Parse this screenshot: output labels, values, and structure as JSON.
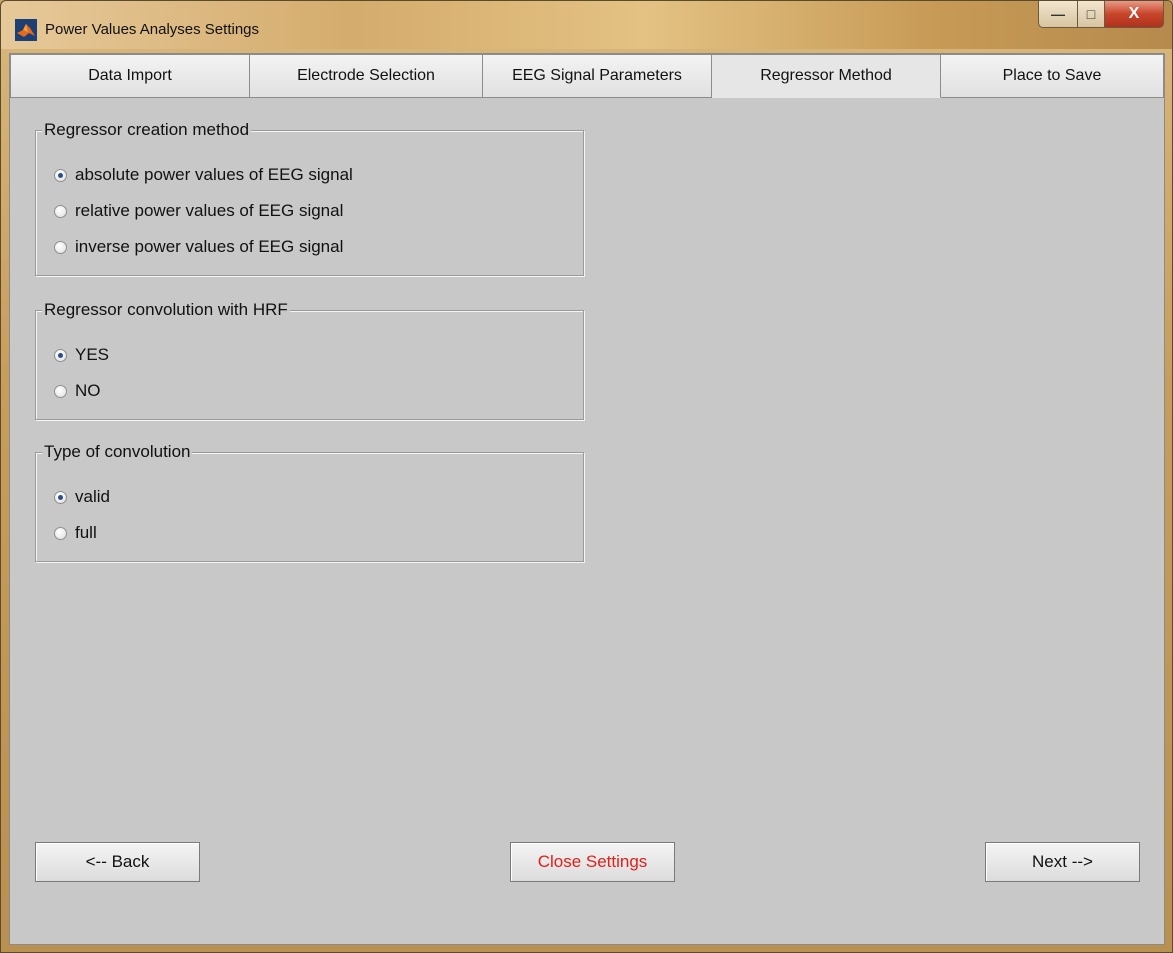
{
  "window": {
    "title": "Power Values Analyses Settings",
    "controls": {
      "minimize": "—",
      "maximize": "□",
      "close": "X"
    }
  },
  "tabs": [
    {
      "label": "Data Import",
      "active": false
    },
    {
      "label": "Electrode Selection",
      "active": false
    },
    {
      "label": "EEG Signal Parameters",
      "active": false
    },
    {
      "label": "Regressor Method",
      "active": true
    },
    {
      "label": "Place to Save",
      "active": false
    }
  ],
  "groups": {
    "creation": {
      "title": "Regressor creation method",
      "options": [
        {
          "label": "absolute power values of EEG signal",
          "checked": true
        },
        {
          "label": "relative power values of EEG signal",
          "checked": false
        },
        {
          "label": "inverse power values of EEG signal",
          "checked": false
        }
      ]
    },
    "convolution": {
      "title": "Regressor convolution with HRF",
      "options": [
        {
          "label": "YES",
          "checked": true
        },
        {
          "label": "NO",
          "checked": false
        }
      ]
    },
    "type": {
      "title": "Type of convolution",
      "options": [
        {
          "label": "valid",
          "checked": true
        },
        {
          "label": "full",
          "checked": false
        }
      ]
    }
  },
  "buttons": {
    "back": "<-- Back",
    "close_settings": "Close Settings",
    "next": "Next -->"
  },
  "colors": {
    "close_settings_text": "#e0201a",
    "radio_dot": "#2a4f88",
    "panel_background": "#c8c8c8"
  },
  "icons": {
    "app": "matlab-logo-icon"
  }
}
